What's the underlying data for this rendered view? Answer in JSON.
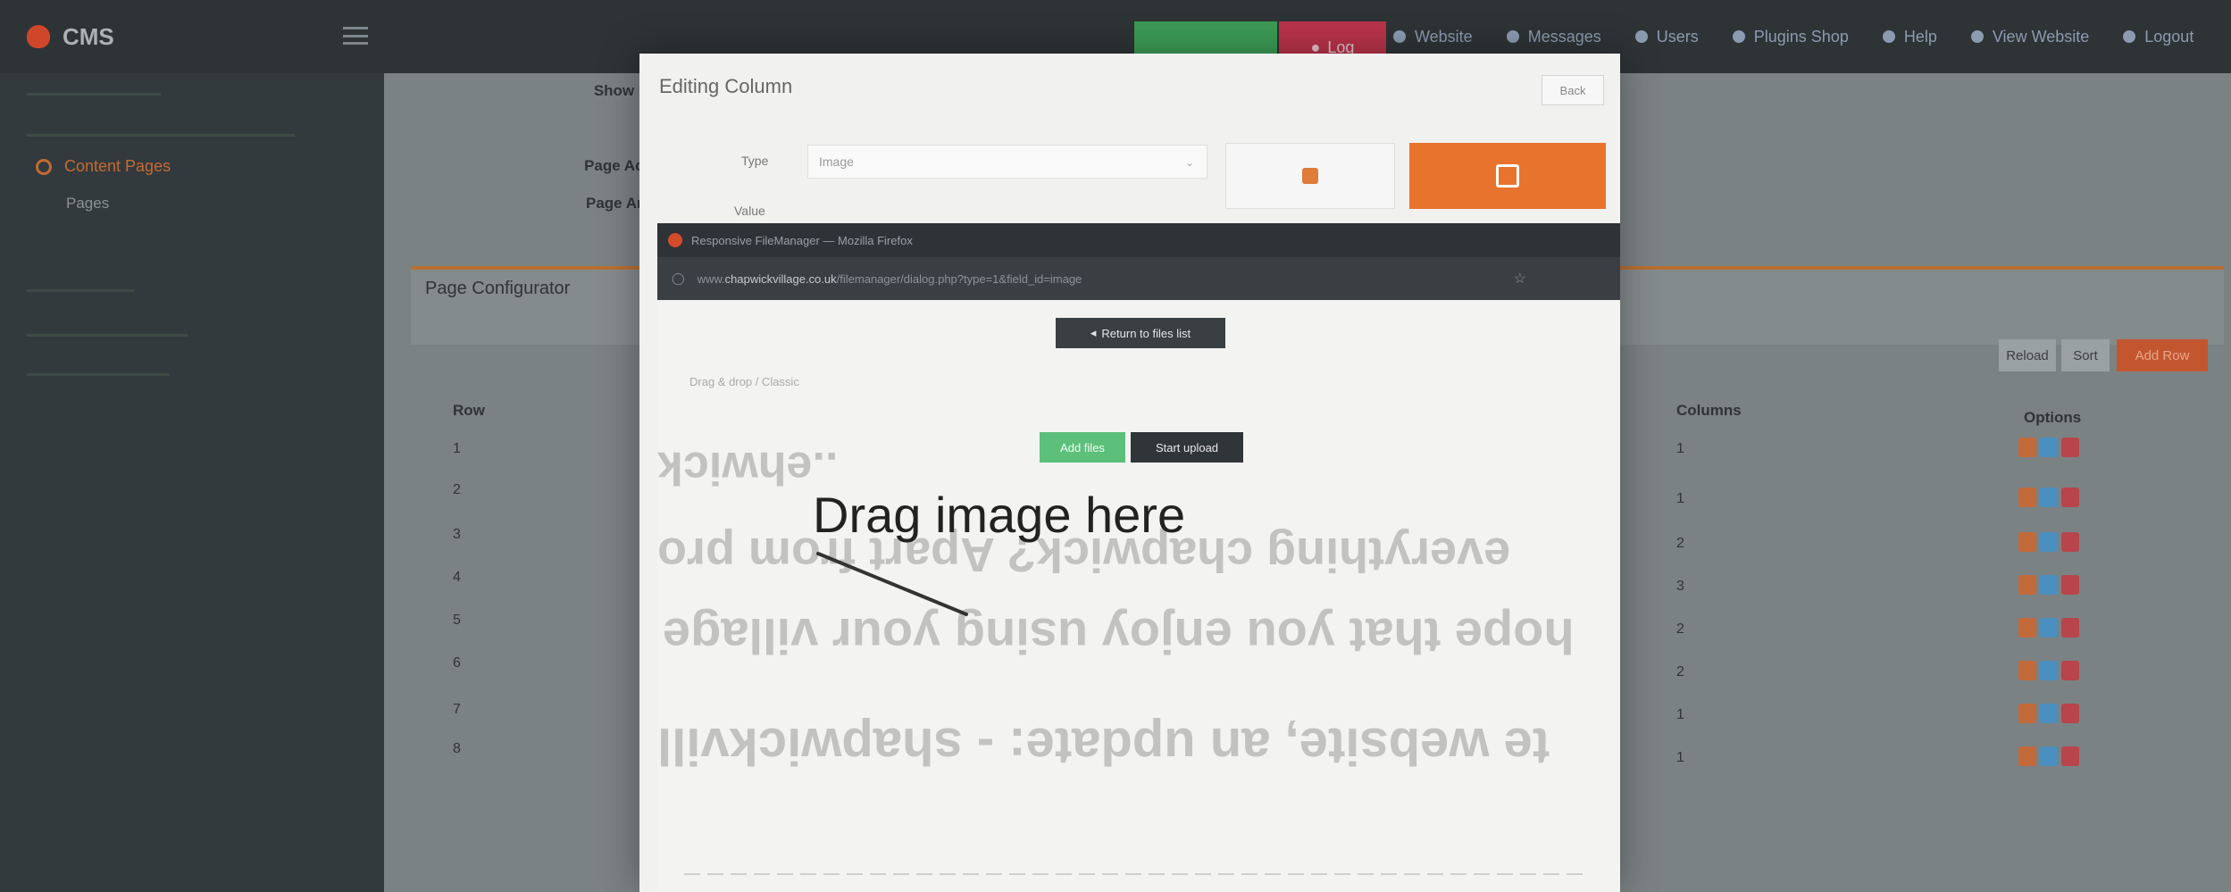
{
  "topbar": {
    "brand": "CMS",
    "red_label": "Log",
    "nav": [
      "Website",
      "Messages",
      "Users",
      "Plugins Shop",
      "Help",
      "View Website",
      "Logout"
    ]
  },
  "sidebar": {
    "active_item": "Content Pages",
    "sub_item": "Pages"
  },
  "main": {
    "form_labels": [
      "Show in",
      "Page Acc",
      "Page Arg"
    ],
    "panel_title": "Page Configurator",
    "buttons": {
      "reload": "Reload",
      "sort": "Sort",
      "add": "Add Row"
    },
    "table_headers": {
      "row": "Row",
      "columns": "Columns",
      "options": "Options"
    },
    "rows": [
      {
        "row": "1",
        "columns": "1"
      },
      {
        "row": "2",
        "columns": "1"
      },
      {
        "row": "3",
        "columns": "2"
      },
      {
        "row": "4",
        "columns": "3"
      },
      {
        "row": "5",
        "columns": "2"
      },
      {
        "row": "6",
        "columns": "2"
      },
      {
        "row": "7",
        "columns": "1"
      },
      {
        "row": "8",
        "columns": "1"
      }
    ]
  },
  "modal": {
    "title": "Editing Column",
    "back": "Back",
    "type_label": "Type",
    "type_value": "Image",
    "value_label": "Value"
  },
  "browser": {
    "window_title": "Responsive FileManager — Mozilla Firefox",
    "url_host": "chapwickvillage.co.uk",
    "url_prefix": "www.",
    "url_rest": "/filemanager/dialog.php?type=1&field_id=image",
    "return_btn": "Return to files list",
    "tabs": "Drag & drop  /  Classic",
    "add_files": "Add files",
    "start_upload": "Start upload",
    "drag_text": "Drag image here",
    "ghost_lines": [
      "..ehwick",
      "everything chapwick? Apart from pro",
      "hope that you enjoy using your village",
      "te website, an update: - shapwickvill"
    ]
  },
  "colors": {
    "accent_orange": "#e8732d",
    "add_green": "#5cc07a",
    "dark_button": "#303538"
  }
}
